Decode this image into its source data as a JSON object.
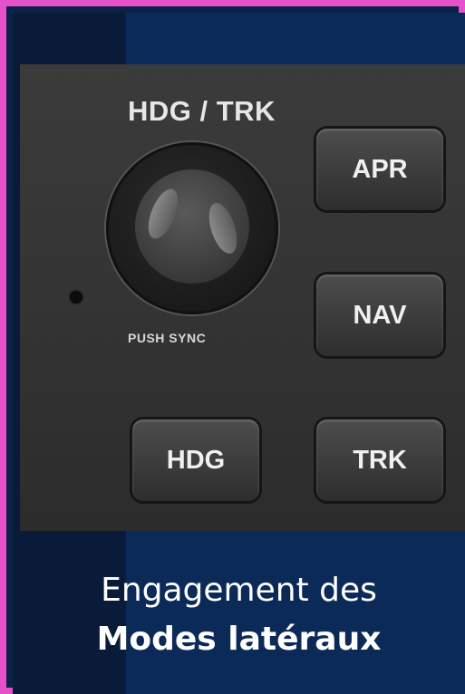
{
  "colors": {
    "border": "#e650c8",
    "background": "#0b2148",
    "panel": "#363636",
    "button_text": "#f0f0f0"
  },
  "panel": {
    "knob_label": "HDG / TRK",
    "knob_sub_label": "PUSH SYNC",
    "buttons": {
      "apr": "APR",
      "nav": "NAV",
      "hdg": "HDG",
      "trk": "TRK"
    }
  },
  "caption": {
    "line1": "Engagement des",
    "line2": "Modes latéraux"
  }
}
